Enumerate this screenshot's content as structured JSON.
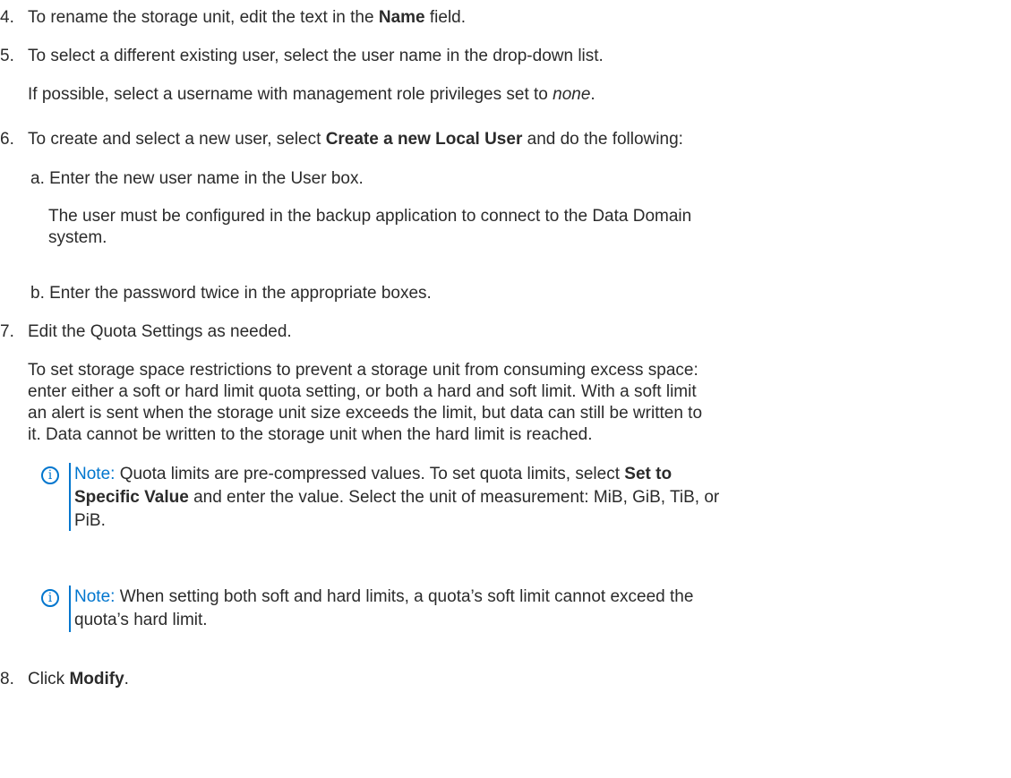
{
  "steps": {
    "s4": {
      "num": "4.",
      "pre": "To rename the storage unit, edit the text in the ",
      "bold": "Name",
      "post": " field."
    },
    "s5": {
      "num": "5.",
      "text": "To select a different existing user, select the user name in the drop-down list.",
      "sub_pre": "If possible, select a username with management role privileges set to ",
      "sub_italic": "none",
      "sub_post": "."
    },
    "s6": {
      "num": "6.",
      "pre": "To create and select a new user, select ",
      "bold": "Create a new Local User",
      "post": " and do the following:",
      "a": "a. Enter the new user name in the User box.",
      "a_note_1": "The user must be configured in the backup application to connect to the Data Domain",
      "a_note_2": "system.",
      "b": "b. Enter the password twice in the appropriate boxes."
    },
    "s7": {
      "num": "7.",
      "text": "Edit the Quota Settings as needed.",
      "para_1": "To set storage space restrictions to prevent a storage unit from consuming excess space:",
      "para_2": "enter either a soft or hard limit quota setting, or both a hard and soft limit. With a soft limit",
      "para_3": "an alert is sent when the storage unit size exceeds the limit, but data can still be written to",
      "para_4": "it. Data cannot be written to the storage unit when the hard limit is reached."
    },
    "s8": {
      "num": "8.",
      "pre": "Click ",
      "bold": "Modify",
      "post": "."
    }
  },
  "notes": {
    "n1": {
      "icon": "info-icon",
      "label": "Note:",
      "l1_pre": " Quota limits are pre-compressed values. To set quota limits, select ",
      "l1_bold": "Set to",
      "l2_bold": "Specific Value",
      "l2_post": " and enter the value. Select the unit of measurement: MiB, GiB, TiB, or",
      "l3": "PiB."
    },
    "n2": {
      "icon": "info-icon",
      "label": "Note:",
      "l1": " When setting both soft and hard limits, a quota’s soft limit cannot exceed the",
      "l2": "quota’s hard limit."
    }
  },
  "colors": {
    "text": "#2b2b2b",
    "accent": "#0076ce"
  }
}
